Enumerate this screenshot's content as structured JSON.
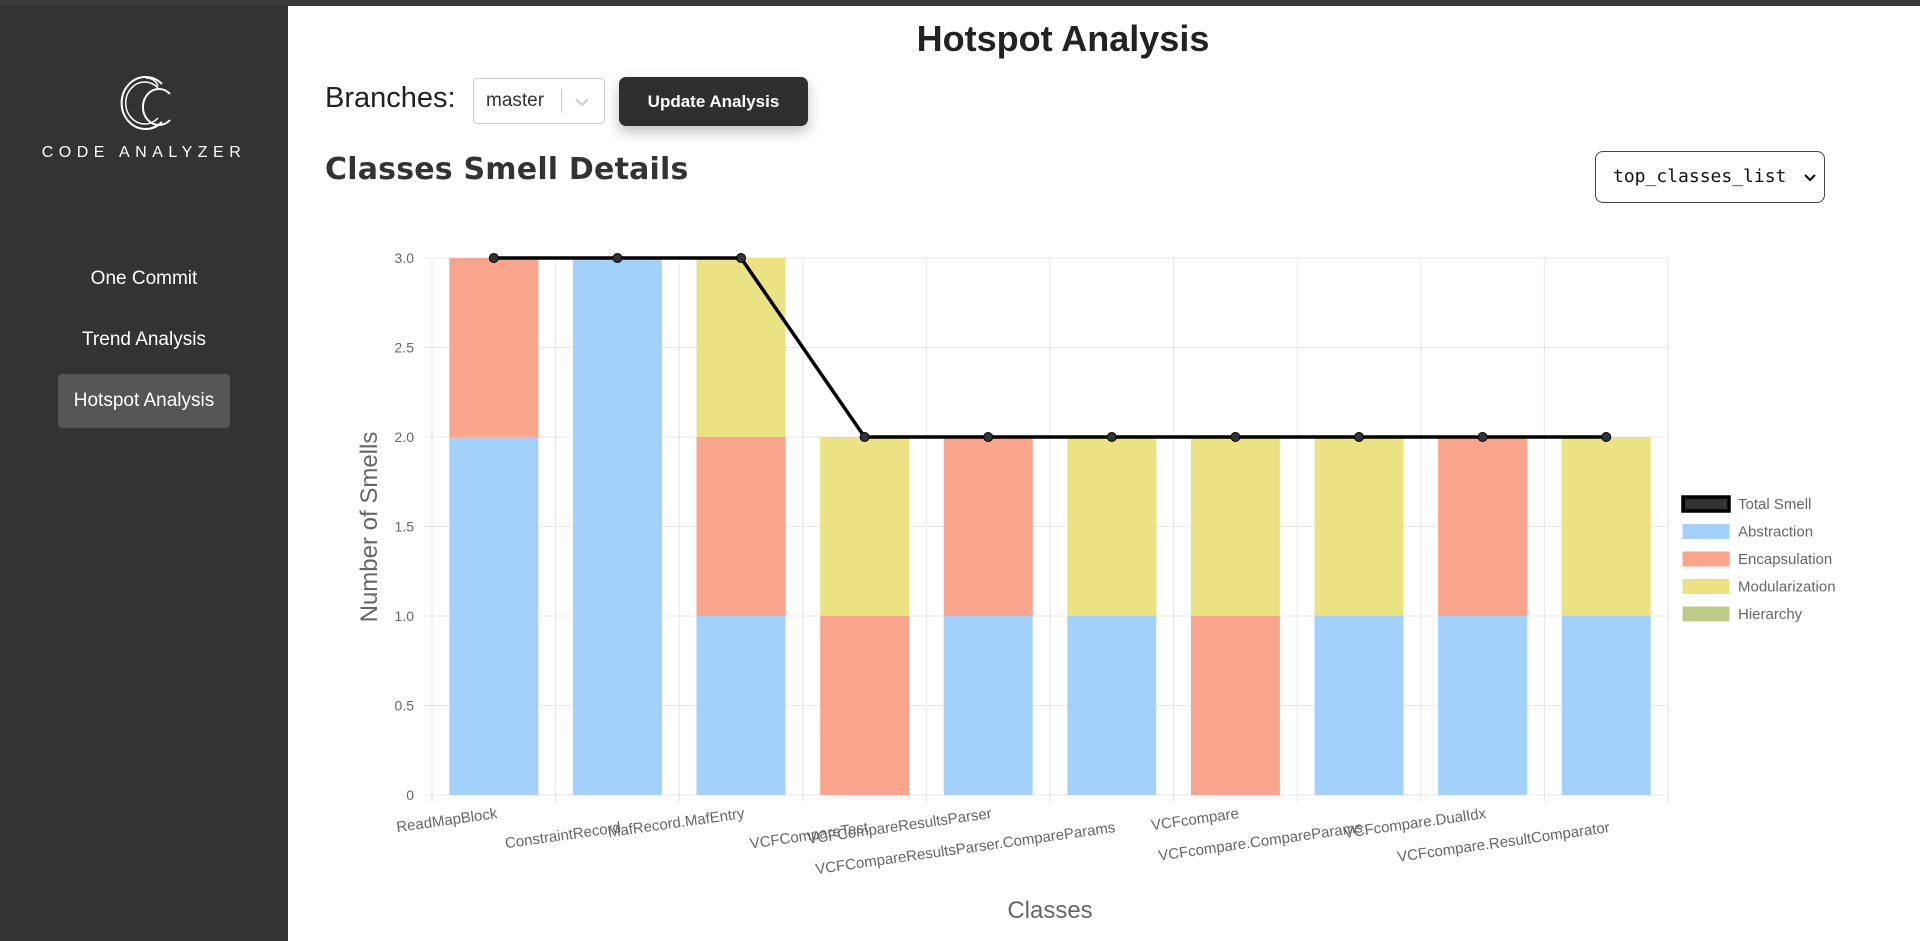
{
  "app": {
    "logo_text": "CODE ANALYZER"
  },
  "sidebar": {
    "items": [
      {
        "label": "One Commit",
        "active": false
      },
      {
        "label": "Trend Analysis",
        "active": false
      },
      {
        "label": "Hotspot Analysis",
        "active": true
      }
    ]
  },
  "header": {
    "title": "Hotspot Analysis",
    "branches_label": "Branches:",
    "branch_value": "master",
    "update_button": "Update Analysis"
  },
  "section": {
    "title": "Classes Smell Details",
    "list_select_value": "top_classes_list"
  },
  "colors": {
    "sidebar_bg": "#333333",
    "abstraction": "#a3d1fc",
    "encapsulation": "#f9a48d",
    "modularization": "#eae283",
    "hierarchy": "#bccb88",
    "total_line": "#000000"
  },
  "chart_data": {
    "type": "bar",
    "stacked": true,
    "xlabel": "Classes",
    "ylabel": "Number of Smells",
    "ylim": [
      0,
      3
    ],
    "yticks": [
      "0",
      "0.5",
      "1.0",
      "1.5",
      "2.0",
      "2.5",
      "3.0"
    ],
    "grid": true,
    "legend_position": "right",
    "categories": [
      "ReadMapBlock",
      "ConstraintRecord",
      "MafRecord.MafEntry",
      "VCFCompareTest",
      "VCFCompareResultsParser",
      "VCFCompareResultsParser.CompareParams",
      "VCFcompare",
      "VCFcompare.CompareParams",
      "VCFcompare.DualIdx",
      "VCFcompare.ResultComparator"
    ],
    "line_series": {
      "name": "Total Smell",
      "values": [
        3,
        3,
        3,
        2,
        2,
        2,
        2,
        2,
        2,
        2
      ]
    },
    "series": [
      {
        "name": "Abstraction",
        "color": "#a3d1fc",
        "values": [
          2,
          3,
          1,
          0,
          1,
          1,
          0,
          1,
          1,
          1
        ]
      },
      {
        "name": "Encapsulation",
        "color": "#f9a48d",
        "values": [
          1,
          0,
          1,
          1,
          1,
          0,
          1,
          0,
          1,
          0
        ]
      },
      {
        "name": "Modularization",
        "color": "#eae283",
        "values": [
          0,
          0,
          1,
          1,
          0,
          1,
          1,
          1,
          0,
          1
        ]
      },
      {
        "name": "Hierarchy",
        "color": "#bccb88",
        "values": [
          0,
          0,
          0,
          0,
          0,
          0,
          0,
          0,
          0,
          0
        ]
      }
    ]
  }
}
